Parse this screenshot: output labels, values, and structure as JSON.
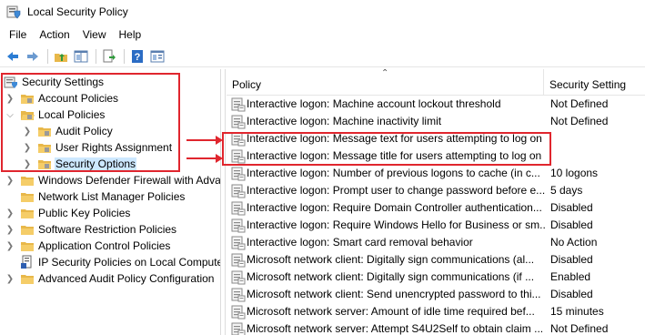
{
  "window": {
    "title": "Local Security Policy"
  },
  "menu": [
    "File",
    "Action",
    "View",
    "Help"
  ],
  "toolbar": {
    "icons": [
      "back-arrow-icon",
      "forward-arrow-icon",
      "up-folder-icon",
      "show-hide-tree-icon",
      "export-list-icon",
      "help-icon",
      "properties-icon"
    ]
  },
  "tree": [
    {
      "label": "Security Settings",
      "expanded": true,
      "level": 0,
      "icon": "shield-folder"
    },
    {
      "label": "Account Policies",
      "expanded": false,
      "level": 1,
      "icon": "folder"
    },
    {
      "label": "Local Policies",
      "expanded": true,
      "level": 1,
      "icon": "folder"
    },
    {
      "label": "Audit Policy",
      "expanded": false,
      "level": 2,
      "icon": "folder"
    },
    {
      "label": "User Rights Assignment",
      "expanded": false,
      "level": 2,
      "icon": "folder"
    },
    {
      "label": "Security Options",
      "expanded": false,
      "level": 2,
      "icon": "folder",
      "selected": true
    },
    {
      "label": "Windows Defender Firewall with Advanced Security",
      "expanded": false,
      "level": 1,
      "icon": "folder"
    },
    {
      "label": "Network List Manager Policies",
      "expanded": false,
      "level": 1,
      "icon": "folder"
    },
    {
      "label": "Public Key Policies",
      "expanded": false,
      "level": 1,
      "icon": "folder"
    },
    {
      "label": "Software Restriction Policies",
      "expanded": false,
      "level": 1,
      "icon": "folder"
    },
    {
      "label": "Application Control Policies",
      "expanded": false,
      "level": 1,
      "icon": "folder"
    },
    {
      "label": "IP Security Policies on Local Computer",
      "expanded": false,
      "level": 1,
      "icon": "ip-security"
    },
    {
      "label": "Advanced Audit Policy Configuration",
      "expanded": false,
      "level": 1,
      "icon": "folder"
    }
  ],
  "list": {
    "columns": {
      "policy": "Policy",
      "setting": "Security Setting"
    },
    "rows": [
      {
        "policy": "Interactive logon: Machine account lockout threshold",
        "setting": "Not Defined"
      },
      {
        "policy": "Interactive logon: Machine inactivity limit",
        "setting": "Not Defined"
      },
      {
        "policy": "Interactive logon: Message text for users attempting to log on",
        "setting": ""
      },
      {
        "policy": "Interactive logon: Message title for users attempting to log on",
        "setting": ""
      },
      {
        "policy": "Interactive logon: Number of previous logons to cache (in c...",
        "setting": "10 logons"
      },
      {
        "policy": "Interactive logon: Prompt user to change password before e...",
        "setting": "5 days"
      },
      {
        "policy": "Interactive logon: Require Domain Controller authentication...",
        "setting": "Disabled"
      },
      {
        "policy": "Interactive logon: Require Windows Hello for Business or sm...",
        "setting": "Disabled"
      },
      {
        "policy": "Interactive logon: Smart card removal behavior",
        "setting": "No Action"
      },
      {
        "policy": "Microsoft network client: Digitally sign communications (al...",
        "setting": "Disabled"
      },
      {
        "policy": "Microsoft network client: Digitally sign communications (if ...",
        "setting": "Enabled"
      },
      {
        "policy": "Microsoft network client: Send unencrypted password to thi...",
        "setting": "Disabled"
      },
      {
        "policy": "Microsoft network server: Amount of idle time required bef...",
        "setting": "15 minutes"
      },
      {
        "policy": "Microsoft network server: Attempt S4U2Self to obtain claim ...",
        "setting": "Not Defined"
      }
    ]
  },
  "colors": {
    "highlight": "#e0262e",
    "selection": "#cde8ff",
    "folder": "#e8b84a"
  }
}
